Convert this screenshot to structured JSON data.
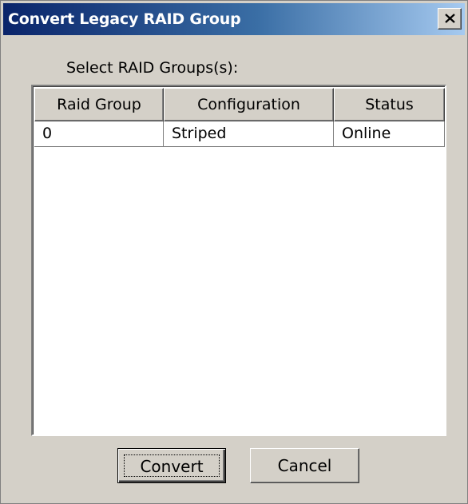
{
  "window": {
    "title": "Convert Legacy RAID Group",
    "close_label": "X"
  },
  "prompt": "Select RAID Groups(s):",
  "table": {
    "columns": [
      "Raid Group",
      "Configuration",
      "Status"
    ],
    "rows": [
      [
        "0",
        "Striped",
        "Online"
      ]
    ]
  },
  "buttons": {
    "convert": "Convert",
    "cancel": "Cancel"
  }
}
